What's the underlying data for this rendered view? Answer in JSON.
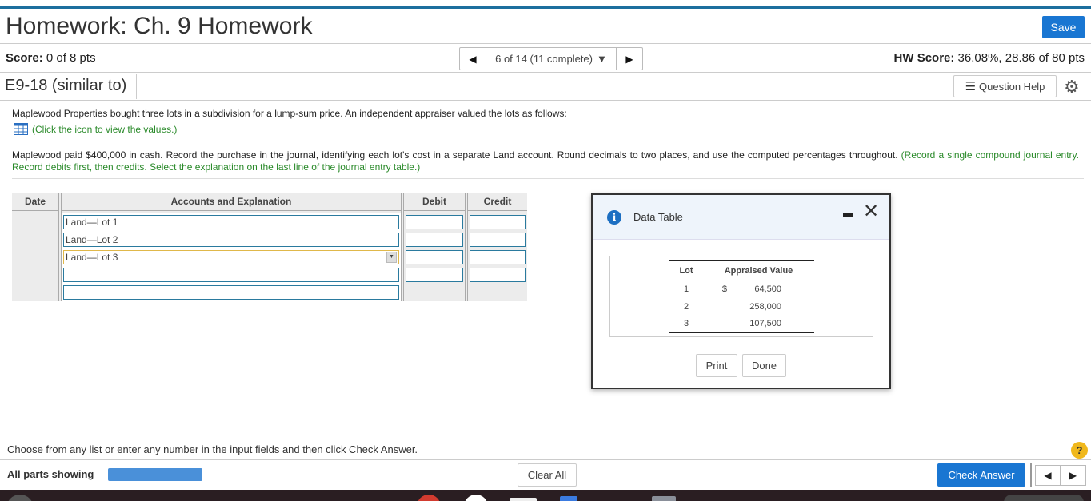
{
  "header": {
    "title": "Homework: Ch. 9 Homework",
    "save_label": "Save",
    "score_label": "Score:",
    "score_value": "0 of 8 pts",
    "nav_status": "6 of 14 (11 complete)",
    "hw_score_label": "HW Score:",
    "hw_score_value": "36.08%, 28.86 of 80 pts"
  },
  "question": {
    "id": "E9-18 (similar to)",
    "help_label": "Question Help",
    "intro": "Maplewood Properties bought three lots in a subdivision for a lump-sum price. An independent appraiser valued the lots as follows:",
    "icon_link": "(Click the icon to view the values.)",
    "instructions": "Maplewood paid $400,000 in cash. Record the purchase in the journal, identifying each lot's cost in a separate Land account. Round decimals to two places, and use the computed percentages throughout.",
    "instructions_hint": "(Record a single compound journal entry. Record debits first, then credits. Select the explanation on the last line of the journal entry table.)"
  },
  "journal": {
    "headers": {
      "date": "Date",
      "accounts": "Accounts and Explanation",
      "debit": "Debit",
      "credit": "Credit"
    },
    "rows": [
      {
        "account": "Land—Lot 1",
        "debit": "",
        "credit": ""
      },
      {
        "account": "Land—Lot 2",
        "debit": "",
        "credit": ""
      },
      {
        "account": "Land—Lot 3",
        "debit": "",
        "credit": ""
      },
      {
        "account": "",
        "debit": "",
        "credit": ""
      }
    ],
    "explanation": ""
  },
  "data_table": {
    "title": "Data Table",
    "col_lot": "Lot",
    "col_value": "Appraised Value",
    "currency": "$",
    "rows": [
      {
        "lot": "1",
        "value": "64,500"
      },
      {
        "lot": "2",
        "value": "258,000"
      },
      {
        "lot": "3",
        "value": "107,500"
      }
    ],
    "print_label": "Print",
    "done_label": "Done"
  },
  "footer": {
    "instruction": "Choose from any list or enter any number in the input fields and then click Check Answer.",
    "all_parts": "All parts showing",
    "progress": 1.0,
    "clear_all": "Clear All",
    "check_answer": "Check Answer"
  },
  "colors": {
    "accent": "#1976d2",
    "hint_green": "#2a8a2a",
    "progress": "#4a90d9"
  }
}
